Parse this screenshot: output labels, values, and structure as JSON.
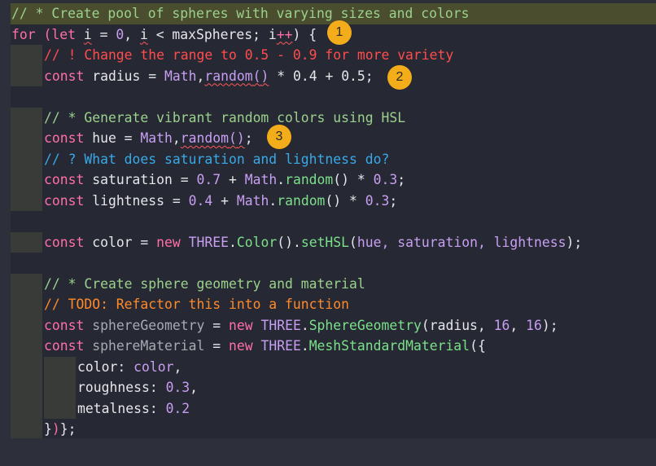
{
  "colors": {
    "background": "#2d303a",
    "editor_background": "#262833",
    "comment_highlight": "#4a4d2e",
    "indent_guide": "#383b38",
    "badge": "#f3ad1b"
  },
  "code": {
    "lines": [
      [
        {
          "t": "// * Create pool of spheres with varying sizes and colors",
          "c": "#9bd18c"
        }
      ],
      [
        {
          "t": "for",
          "c": "#ff6fa8"
        },
        {
          "t": " ",
          "c": "#e6e6ea"
        },
        {
          "t": "(",
          "c": "#ff6fa8"
        },
        {
          "t": "let",
          "c": "#ff6fa8"
        },
        {
          "t": " ",
          "c": "#e6e6ea"
        },
        {
          "t": "i",
          "c": "#e6e6ea",
          "u": true
        },
        {
          "t": " = ",
          "c": "#e6e6ea"
        },
        {
          "t": "0",
          "c": "#c89ff2"
        },
        {
          "t": ", ",
          "c": "#e6e6ea"
        },
        {
          "t": "i",
          "c": "#e6e6ea",
          "u": true
        },
        {
          "t": " < maxSpheres; ",
          "c": "#e6e6ea"
        },
        {
          "t": "i",
          "c": "#e6e6ea"
        },
        {
          "t": "++",
          "c": "#ff6fa8",
          "u": true
        },
        {
          "t": ") {",
          "c": "#e6e6ea"
        }
      ],
      [
        {
          "t": "// ! Change the range to 0.5 - 0.9 for more variety",
          "c": "#ff4d4d"
        }
      ],
      [
        {
          "t": "const",
          "c": "#ff6fa8"
        },
        {
          "t": " radius = ",
          "c": "#e6e6ea"
        },
        {
          "t": "Math",
          "c": "#c89ff2"
        },
        {
          "t": ",",
          "c": "#e6e6ea"
        },
        {
          "t": "random",
          "c": "#c89ff2",
          "u": true
        },
        {
          "t": "(",
          "c": "#c89ff2",
          "u": true
        },
        {
          "t": ")",
          "c": "#c89ff2",
          "u": true
        },
        {
          "t": " * ",
          "c": "#e6e6ea"
        },
        {
          "t": "0.4",
          "c": "#e6e6ea"
        },
        {
          "t": " + ",
          "c": "#e6e6ea"
        },
        {
          "t": "0.5",
          "c": "#e6e6ea"
        },
        {
          "t": ";",
          "c": "#e6e6ea"
        }
      ],
      [],
      [
        {
          "t": "// * Generate vibrant random colors using HSL",
          "c": "#9bd18c"
        }
      ],
      [
        {
          "t": "const",
          "c": "#ff6fa8"
        },
        {
          "t": " hue = ",
          "c": "#e6e6ea"
        },
        {
          "t": "Math",
          "c": "#c89ff2"
        },
        {
          "t": ",",
          "c": "#e6e6ea"
        },
        {
          "t": "random",
          "c": "#c89ff2",
          "u": true
        },
        {
          "t": "(",
          "c": "#c89ff2",
          "u": true
        },
        {
          "t": ")",
          "c": "#c89ff2",
          "u": true
        },
        {
          "t": ";",
          "c": "#e6e6ea"
        }
      ],
      [
        {
          "t": "// ? What does saturation and lightness do?",
          "c": "#39a9e8"
        }
      ],
      [
        {
          "t": "const",
          "c": "#ff6fa8"
        },
        {
          "t": " saturation = ",
          "c": "#e6e6ea"
        },
        {
          "t": "0.7",
          "c": "#c89ff2"
        },
        {
          "t": " + ",
          "c": "#e6e6ea"
        },
        {
          "t": "Math",
          "c": "#c89ff2"
        },
        {
          "t": ".",
          "c": "#e6e6ea"
        },
        {
          "t": "random",
          "c": "#7be08a"
        },
        {
          "t": "()",
          "c": "#e6e6ea"
        },
        {
          "t": " * ",
          "c": "#e6e6ea"
        },
        {
          "t": "0.3",
          "c": "#c89ff2"
        },
        {
          "t": ";",
          "c": "#e6e6ea"
        }
      ],
      [
        {
          "t": "const",
          "c": "#ff6fa8"
        },
        {
          "t": " lightness = ",
          "c": "#e6e6ea"
        },
        {
          "t": "0.4",
          "c": "#c89ff2"
        },
        {
          "t": " + ",
          "c": "#e6e6ea"
        },
        {
          "t": "Math",
          "c": "#c89ff2"
        },
        {
          "t": ".",
          "c": "#e6e6ea"
        },
        {
          "t": "random",
          "c": "#7be08a"
        },
        {
          "t": "()",
          "c": "#e6e6ea"
        },
        {
          "t": " * ",
          "c": "#e6e6ea"
        },
        {
          "t": "0.3",
          "c": "#c89ff2"
        },
        {
          "t": ";",
          "c": "#e6e6ea"
        }
      ],
      [],
      [
        {
          "t": "const",
          "c": "#ff6fa8"
        },
        {
          "t": " color = ",
          "c": "#e6e6ea"
        },
        {
          "t": "new",
          "c": "#ff6fa8"
        },
        {
          "t": " ",
          "c": "#e6e6ea"
        },
        {
          "t": "THREE",
          "c": "#c89ff2"
        },
        {
          "t": ".",
          "c": "#e6e6ea"
        },
        {
          "t": "Color",
          "c": "#7be08a"
        },
        {
          "t": "()",
          "c": "#e6e6ea"
        },
        {
          "t": ".",
          "c": "#e6e6ea"
        },
        {
          "t": "setHSL",
          "c": "#7be08a"
        },
        {
          "t": "(",
          "c": "#e6e6ea"
        },
        {
          "t": "hue, saturation, lightness",
          "c": "#c89ff2"
        },
        {
          "t": ");",
          "c": "#e6e6ea"
        }
      ],
      [],
      [
        {
          "t": "// * Create sphere geometry and material",
          "c": "#9bd18c"
        }
      ],
      [
        {
          "t": "// TODO: Refactor this into a function",
          "c": "#ff8a2a"
        }
      ],
      [
        {
          "t": "const",
          "c": "#ff6fa8"
        },
        {
          "t": " sphereGeometry",
          "c": "#a9a9b2"
        },
        {
          "t": " = ",
          "c": "#e6e6ea"
        },
        {
          "t": "new",
          "c": "#ff6fa8"
        },
        {
          "t": " ",
          "c": "#e6e6ea"
        },
        {
          "t": "THREE",
          "c": "#c89ff2"
        },
        {
          "t": ".",
          "c": "#e6e6ea"
        },
        {
          "t": "SphereGeometry",
          "c": "#7be08a"
        },
        {
          "t": "(",
          "c": "#e6e6ea"
        },
        {
          "t": "radius, ",
          "c": "#e6e6ea"
        },
        {
          "t": "16",
          "c": "#c89ff2"
        },
        {
          "t": ", ",
          "c": "#e6e6ea"
        },
        {
          "t": "16",
          "c": "#c89ff2"
        },
        {
          "t": ");",
          "c": "#e6e6ea"
        }
      ],
      [
        {
          "t": "const",
          "c": "#ff6fa8"
        },
        {
          "t": " sphereMaterial",
          "c": "#a9a9b2"
        },
        {
          "t": " = ",
          "c": "#e6e6ea"
        },
        {
          "t": "new",
          "c": "#ff6fa8"
        },
        {
          "t": " ",
          "c": "#e6e6ea"
        },
        {
          "t": "THREE",
          "c": "#c89ff2"
        },
        {
          "t": ".",
          "c": "#e6e6ea"
        },
        {
          "t": "MeshStandardMaterial",
          "c": "#7be08a"
        },
        {
          "t": "(",
          "c": "#e6e6ea"
        },
        {
          "t": "{",
          "c": "#e6e6ea"
        }
      ],
      [
        {
          "t": "color",
          "c": "#e6e6ea"
        },
        {
          "t": ": ",
          "c": "#e6e6ea"
        },
        {
          "t": "color",
          "c": "#c89ff2"
        },
        {
          "t": ",",
          "c": "#e6e6ea"
        }
      ],
      [
        {
          "t": "roughness",
          "c": "#e6e6ea"
        },
        {
          "t": ": ",
          "c": "#e6e6ea"
        },
        {
          "t": "0.3",
          "c": "#c89ff2"
        },
        {
          "t": ",",
          "c": "#e6e6ea"
        }
      ],
      [
        {
          "t": "metalness",
          "c": "#e6e6ea"
        },
        {
          "t": ": ",
          "c": "#e6e6ea"
        },
        {
          "t": "0.2",
          "c": "#c89ff2"
        }
      ],
      [
        {
          "t": "}",
          "c": "#e6e6ea"
        },
        {
          "t": ")",
          "c": "#ff6fa8"
        },
        {
          "t": "};",
          "c": "#e6e6ea"
        }
      ]
    ]
  },
  "badges": [
    "1",
    "2",
    "3"
  ]
}
